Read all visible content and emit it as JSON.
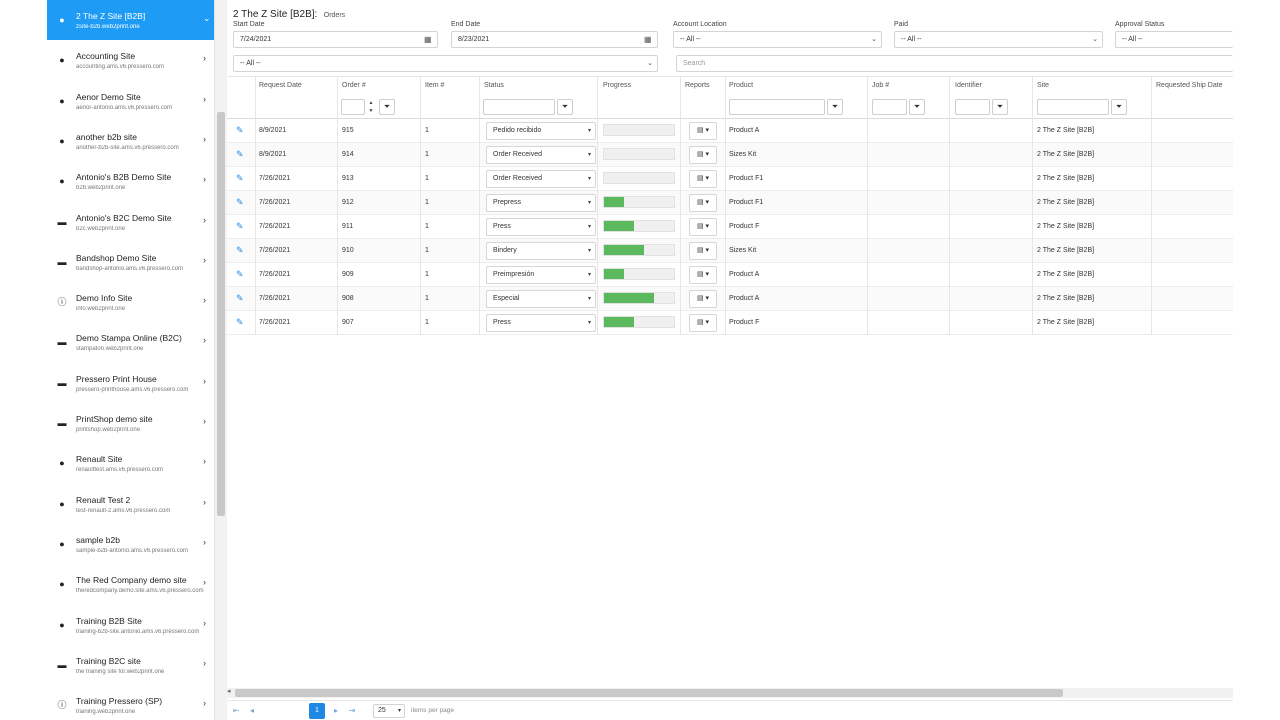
{
  "breadcrumb": {
    "title": "2 The Z Site [B2B]:",
    "section": "Orders"
  },
  "sites": [
    {
      "name": "2 The Z Site [B2B]",
      "url": "zsite-b2b.web2print.one",
      "icon": "person-icon",
      "active": true
    },
    {
      "name": "Accounting Site",
      "url": "accounting.ams.v6.pressero.com",
      "icon": "person-icon",
      "active": false
    },
    {
      "name": "Aenor Demo Site",
      "url": "aenor-antonio.ams.v6.pressero.com",
      "icon": "person-icon",
      "active": false
    },
    {
      "name": "another b2b site",
      "url": "another-b2b-site.ams.v6.pressero.com",
      "icon": "person-icon",
      "active": false
    },
    {
      "name": "Antonio's B2B Demo Site",
      "url": "b2b.web2print.one",
      "icon": "person-icon",
      "active": false
    },
    {
      "name": "Antonio's B2C Demo Site",
      "url": "b2c.web2print.one",
      "icon": "cart-icon",
      "active": false
    },
    {
      "name": "Bandshop Demo Site",
      "url": "bandshop-antonio.ams.v6.pressero.com",
      "icon": "cart-icon",
      "active": false
    },
    {
      "name": "Demo Info Site",
      "url": "info.web2print.one",
      "icon": "info-icon",
      "active": false
    },
    {
      "name": "Demo Stampa Online (B2C)",
      "url": "stampaton.web2print.one",
      "icon": "cart-icon",
      "active": false
    },
    {
      "name": "Pressero Print House",
      "url": "pressero-printhouse.ams.v6.pressero.com",
      "icon": "cart-icon",
      "active": false
    },
    {
      "name": "PrintShop demo site",
      "url": "printshop.web2print.one",
      "icon": "cart-icon",
      "active": false
    },
    {
      "name": "Renault Site",
      "url": "renaulttest.ams.v6.pressero.com",
      "icon": "person-icon",
      "active": false
    },
    {
      "name": "Renault Test 2",
      "url": "test-renault-2.ams.v6.pressero.com",
      "icon": "person-icon",
      "active": false
    },
    {
      "name": "sample b2b",
      "url": "sample-b2b-antonio.ams.v6.pressero.com",
      "icon": "person-icon",
      "active": false
    },
    {
      "name": "The Red Company demo site",
      "url": "theredcompany.demo.site.ams.v6.pressero.com",
      "icon": "person-icon",
      "active": false
    },
    {
      "name": "Training B2B Site",
      "url": "training-b2b-site.antonio.ams.v6.pressero.com",
      "icon": "person-icon",
      "active": false
    },
    {
      "name": "Training B2C site",
      "url": "the training site for.web2print.one",
      "icon": "cart-icon",
      "active": false
    },
    {
      "name": "Training Pressero (SP)",
      "url": "training.web2print.one",
      "icon": "info-icon",
      "active": false
    }
  ],
  "filters": {
    "start_date_label": "Start Date",
    "start_date": "7/24/2021",
    "end_date_label": "End Date",
    "end_date": "8/23/2021",
    "account_location_label": "Account Location",
    "account_location": "-- All --",
    "paid_label": "Paid",
    "paid": "-- All --",
    "approval_status_label": "Approval Status",
    "approval_status": "-- All --",
    "second_row_select": "-- All --",
    "search_placeholder": "Search"
  },
  "columns": {
    "request_date": "Request Date",
    "order": "Order #",
    "item": "Item #",
    "status": "Status",
    "progress": "Progress",
    "reports": "Reports",
    "product": "Product",
    "job": "Job #",
    "identifier": "Identifier",
    "site": "Site",
    "requested_ship_date": "Requested Ship Date"
  },
  "orders": [
    {
      "date": "8/9/2021",
      "order": "915",
      "item": "1",
      "status": "Pedido recibido",
      "progress": 0,
      "product": "Product A",
      "site": "2 The Z Site [B2B]"
    },
    {
      "date": "8/9/2021",
      "order": "914",
      "item": "1",
      "status": "Order Received",
      "progress": 0,
      "product": "Sizes Kit",
      "site": "2 The Z Site [B2B]"
    },
    {
      "date": "7/26/2021",
      "order": "913",
      "item": "1",
      "status": "Order Received",
      "progress": 0,
      "product": "Product F1",
      "site": "2 The Z Site [B2B]"
    },
    {
      "date": "7/26/2021",
      "order": "912",
      "item": "1",
      "status": "Prepress",
      "progress": 0.28,
      "product": "Product F1",
      "site": "2 The Z Site [B2B]"
    },
    {
      "date": "7/26/2021",
      "order": "911",
      "item": "1",
      "status": "Press",
      "progress": 0.43,
      "product": "Product F",
      "site": "2 The Z Site [B2B]"
    },
    {
      "date": "7/26/2021",
      "order": "910",
      "item": "1",
      "status": "Bindery",
      "progress": 0.57,
      "product": "Sizes Kit",
      "site": "2 The Z Site [B2B]"
    },
    {
      "date": "7/26/2021",
      "order": "909",
      "item": "1",
      "status": "Preimpresión",
      "progress": 0.28,
      "product": "Product A",
      "site": "2 The Z Site [B2B]"
    },
    {
      "date": "7/26/2021",
      "order": "908",
      "item": "1",
      "status": "Especial",
      "progress": 0.72,
      "product": "Product A",
      "site": "2 The Z Site [B2B]"
    },
    {
      "date": "7/26/2021",
      "order": "907",
      "item": "1",
      "status": "Press",
      "progress": 0.43,
      "product": "Product F",
      "site": "2 The Z Site [B2B]"
    }
  ],
  "pager": {
    "current_page": "1",
    "page_size": "25",
    "items_per_page_label": "items per page"
  },
  "colors": {
    "accent": "#1e9bf5",
    "progress": "#5cb85c",
    "link": "#1e88e5"
  }
}
